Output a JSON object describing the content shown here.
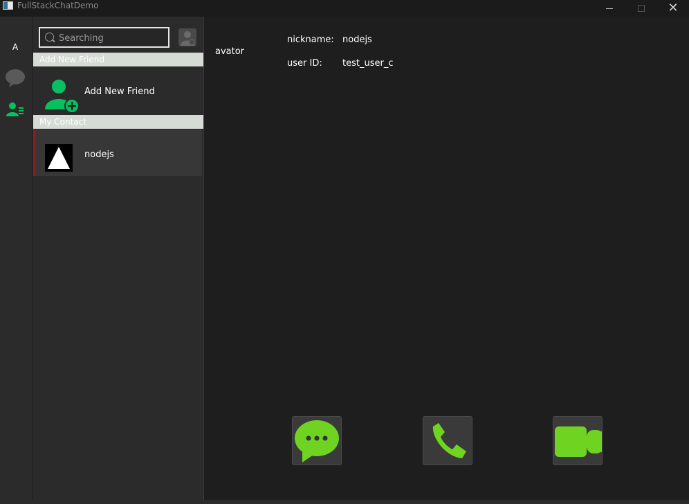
{
  "window": {
    "title": "FullStackChatDemo",
    "controls": [
      "minimize",
      "maximize",
      "close"
    ]
  },
  "side_nav": {
    "avatar_letter": "A",
    "items": [
      {
        "name": "chat",
        "icon": "chat-bubble-icon"
      },
      {
        "name": "contacts",
        "icon": "contact-list-icon",
        "active": true
      }
    ]
  },
  "contact_panel": {
    "search": {
      "placeholder": "Searching",
      "value": ""
    },
    "add_user_icon": "add-user-icon",
    "sections": {
      "add_new_friend": {
        "header": "Add New Friend",
        "item_label": "Add New Friend"
      },
      "my_contact": {
        "header": "My Contact",
        "contacts": [
          {
            "name": "nodejs",
            "selected": true
          }
        ]
      }
    }
  },
  "detail": {
    "avatar_label": "avator",
    "nickname_label": "nickname:",
    "nickname_value": "nodejs",
    "user_id_label": "user ID:",
    "user_id_value": "test_user_c",
    "actions": [
      {
        "name": "message",
        "icon": "message-bubble-icon"
      },
      {
        "name": "voice-call",
        "icon": "phone-icon"
      },
      {
        "name": "video-call",
        "icon": "video-camera-icon"
      }
    ]
  },
  "colors": {
    "background": "#1e1e1e",
    "panel": "#2b2b2b",
    "section_header": "#d7dbd6",
    "accent_green": "#07c160",
    "action_green": "#6fd322",
    "selected_marker": "#8a1f1f"
  }
}
